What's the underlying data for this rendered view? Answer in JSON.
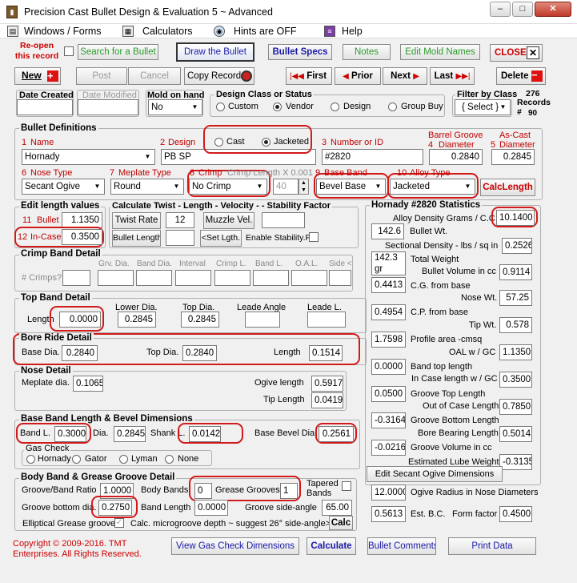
{
  "window": {
    "title": "Precision Cast Bullet Design & Evaluation 5 ~ Advanced",
    "min": "–",
    "max": "□",
    "close": "✕"
  },
  "menu": {
    "windows": "Windows / Forms",
    "calculators": "Calculators",
    "hints": "Hints are OFF",
    "help": "Help"
  },
  "toolbar": {
    "reopen": "Re-open this record",
    "search": "Search for a Bullet",
    "draw": "Draw the Bullet",
    "specs": "Bullet Specs",
    "notes": "Notes",
    "edit_mold": "Edit Mold Names",
    "close": "CLOSE",
    "new": "New",
    "post": "Post",
    "cancel": "Cancel",
    "copy": "Copy Record",
    "first": "First",
    "prior": "Prior",
    "next": "Next",
    "last": "Last",
    "delete": "Delete"
  },
  "record": {
    "date_created_label": "Date Created",
    "date_created": "",
    "date_modified_label": "Date Modified",
    "date_modified": "",
    "mold_label": "Mold on hand",
    "mold_value": "No",
    "design_class_label": "Design Class or Status",
    "class_custom": "Custom",
    "class_vendor": "Vendor",
    "class_design": "Design",
    "class_groupbuy": "Group Buy",
    "filter_label": "Filter by Class",
    "filter_value": "{ Select }",
    "records_count": "276",
    "records_label": "Records",
    "records_num_prefix": "#",
    "records_num": "90"
  },
  "defs": {
    "title": "Bullet Definitions",
    "n1": "1",
    "name_label": "Name",
    "name": "Hornady",
    "n2": "2",
    "design_label": "Design",
    "design": "PB SP",
    "cast": "Cast",
    "jacketed": "Jacketed",
    "n3": "3",
    "number_label": "Number or ID",
    "number": "#2820",
    "n4": "4",
    "groove_label1": "Barrel Groove",
    "groove_label2": "Diameter",
    "groove": "0.2840",
    "n5": "5",
    "ascast_label1": "As-Cast",
    "ascast_label2": "Diameter",
    "ascast": "0.2845",
    "n6": "6",
    "nose_label": "Nose Type",
    "nose": "Secant Ogive",
    "n7": "7",
    "meplate_label": "Meplate Type",
    "meplate": "Round",
    "n8": "8",
    "crimp_label": "Crimp",
    "crimp_len_label": "Crimp Length X 0.001",
    "crimp": "No Crimp",
    "crimp_len": "40",
    "n9": "9",
    "baseband_label": "Base Band",
    "baseband": "Bevel Base",
    "n10": "10",
    "alloy_label": "Alloy Type",
    "alloy": "Jacketed",
    "calc_length": "CalcLength"
  },
  "edit_length": {
    "title": "Edit length values",
    "n11": "11",
    "bullet_label": "Bullet",
    "bullet": "1.1350",
    "n12": "12",
    "incase_label": "In-Case",
    "incase": "0.3500"
  },
  "twist": {
    "title": "Calculate Twist - Length - Velocity - -  Stability Factor",
    "twist_rate": "Twist Rate",
    "twist_value": "12",
    "muzzle_vel": "Muzzle Vel.",
    "muzzle_value": "",
    "bullet_length": "Bullet Length",
    "bl_value": "",
    "set_lgth": "<Set Lgth.",
    "enable_stab": "Enable Stability.F."
  },
  "crimp_band": {
    "title": "Crimp Band Detail",
    "crimps": "# Crimps?",
    "grv_dia": "Grv. Dia.",
    "band_dia": "Band Dia.",
    "interval": "Interval",
    "crimp_l": "Crimp L.",
    "band_l": "Band L.",
    "oal": "O.A.L.",
    "side": "Side <"
  },
  "top_band": {
    "title": "Top Band Detail",
    "length_label": "Length",
    "length": "0.0000",
    "lower_dia_label": "Lower Dia.",
    "lower_dia": "0.2845",
    "top_dia_label": "Top Dia.",
    "top_dia": "0.2845",
    "leade_angle_label": "Leade Angle",
    "leade_angle": "",
    "leade_l_label": "Leade L.",
    "leade_l": ""
  },
  "bore_ride": {
    "title": "Bore Ride Detail",
    "base_dia_label": "Base Dia.",
    "base_dia": "0.2840",
    "top_dia_label": "Top Dia.",
    "top_dia": "0.2840",
    "length_label": "Length",
    "length": "0.1514"
  },
  "nose": {
    "title": "Nose Detail",
    "meplate_label": "Meplate dia.",
    "meplate": "0.1065",
    "ogive_label": "Ogive length",
    "ogive": "0.5917",
    "tip_label": "Tip Length",
    "tip": "0.0419"
  },
  "base_band": {
    "title": "Base Band Length & Bevel Dimensions",
    "band_l_label": "Band L.",
    "band_l": "0.3000",
    "dia_label": "Dia.",
    "dia": "0.2845",
    "shank_label": "Shank L.",
    "shank": "0.0142",
    "bevel_label": "Base Bevel Dia.",
    "bevel": "0.2561",
    "gas_check": "Gas Check",
    "gc_hornady": "Hornady",
    "gc_gator": "Gator",
    "gc_lyman": "Lyman",
    "gc_none": "None"
  },
  "body_band": {
    "title": "Body Band & Grease Groove Detail",
    "ratio_label": "Groove/Band Ratio",
    "ratio": "1.0000",
    "body_bands_label": "Body Bands",
    "body_bands": "0",
    "grease_label": "Grease Grooves",
    "grease": "1",
    "tapered_label1": "Tapered",
    "tapered_label2": "Bands",
    "bottom_label": "Groove bottom dia.",
    "bottom": "0.2750",
    "band_len_label": "Band Length",
    "band_len": "0.0000",
    "side_angle_label": "Groove side-angle",
    "side_angle": "65.00",
    "elliptical": "Elliptical Grease groove",
    "calc_micro": "Calc. microgroove depth ~ suggest 26° side-angle>",
    "calc": "Calc"
  },
  "stats": {
    "title": "Hornady #2820 Statistics",
    "alloy_density_label": "Alloy Density Grams / C.C",
    "alloy_density": "10.1400",
    "bullet_wt": "142.6",
    "bullet_wt_label": "Bullet Wt.",
    "sd_label": "Sectional Density - lbs / sq in",
    "sd": "0.2526",
    "total_wt": "142.3 gr",
    "total_wt_label": "Total  Weight",
    "vol_label": "Bullet Volume in cc",
    "vol": "0.9114",
    "cg": "0.4413",
    "cg_label": "C.G. from base",
    "nose_wt_label": "Nose Wt.",
    "nose_wt": "57.25",
    "cp": "0.4954",
    "cp_label": "C.P. from base",
    "tip_wt_label": "Tip Wt.",
    "tip_wt": "0.578",
    "profile": "1.7598",
    "profile_label": "Profile area -cmsq",
    "oal_gc_label": "OAL w / GC",
    "oal_gc": "1.1350",
    "band_top": "0.0000",
    "band_top_label": "Band top length",
    "incase_gc_label": "In Case length w / GC",
    "incase_gc": "0.3500",
    "groove_top": "0.0500",
    "groove_top_label": "Groove Top Length",
    "out_case_label": "Out of Case Length",
    "out_case": "0.7850",
    "groove_bottom": "-0.3164",
    "groove_bottom_label": "Groove Bottom Length",
    "bore_bearing_label": "Bore Bearing Length",
    "bore_bearing": "0.5014",
    "groove_vol": "-0.0216",
    "groove_vol_label": "Groove Volume in cc",
    "lube_label": "Estimated Lube Weight",
    "lube": "-0.3135",
    "edit_secant": "Edit Secant Ogive Dimensions",
    "ogive_radius": "12.0000",
    "ogive_radius_label": "Ogive Radius in Nose Diameters",
    "est_bc": "0.5613",
    "est_bc_label": "Est. B.C.",
    "form_label": "Form factor",
    "form": "0.4500"
  },
  "footer": {
    "copyright1": "Copyright © 2009-2016. TMT",
    "copyright2": "Enterprises. All Rights Reserved.",
    "gas_dims": "View Gas Check Dimensions",
    "calculate": "Calculate",
    "comments": "Bullet Comments",
    "print": "Print Data"
  }
}
